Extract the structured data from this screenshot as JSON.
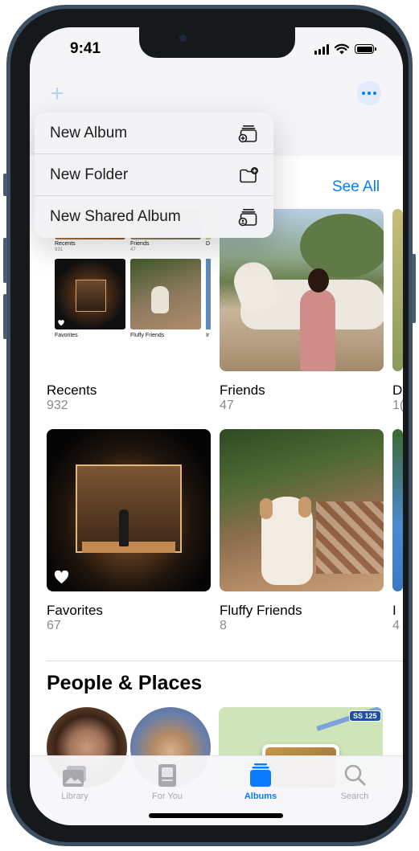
{
  "status_bar": {
    "time": "9:41"
  },
  "header": {
    "add_icon": "plus-icon",
    "more_icon": "ellipsis-icon"
  },
  "menu": {
    "items": [
      {
        "label": "New Album",
        "icon": "album-stack-plus-icon"
      },
      {
        "label": "New Folder",
        "icon": "folder-plus-icon"
      },
      {
        "label": "New Shared Album",
        "icon": "shared-album-icon"
      }
    ]
  },
  "my_albums": {
    "see_all": "See All",
    "albums": [
      {
        "name": "Recents",
        "count": "932"
      },
      {
        "name": "Friends",
        "count": "47"
      },
      {
        "name": "D",
        "count": "1("
      },
      {
        "name": "Favorites",
        "count": "67"
      },
      {
        "name": "Fluffy Friends",
        "count": "8"
      },
      {
        "name": "I",
        "count": "4"
      }
    ],
    "recents_mini_labels": [
      {
        "name": "Recents",
        "count": "931"
      },
      {
        "name": "Friends",
        "count": "47"
      },
      {
        "name": "D",
        "count": ""
      },
      {
        "name": "Favorites",
        "count": ""
      },
      {
        "name": "Fluffy Friends",
        "count": ""
      },
      {
        "name": "Ir",
        "count": ""
      }
    ]
  },
  "people_places": {
    "title": "People & Places",
    "map_badge": "SS 125"
  },
  "tabs": [
    {
      "label": "Library",
      "icon": "library-photos-icon",
      "active": false
    },
    {
      "label": "For You",
      "icon": "for-you-icon",
      "active": false
    },
    {
      "label": "Albums",
      "icon": "albums-icon",
      "active": true
    },
    {
      "label": "Search",
      "icon": "search-icon",
      "active": false
    }
  ],
  "colors": {
    "accent": "#0a7aff",
    "frame": "#3d4f60",
    "inactive_tab": "#a8a8ac"
  }
}
